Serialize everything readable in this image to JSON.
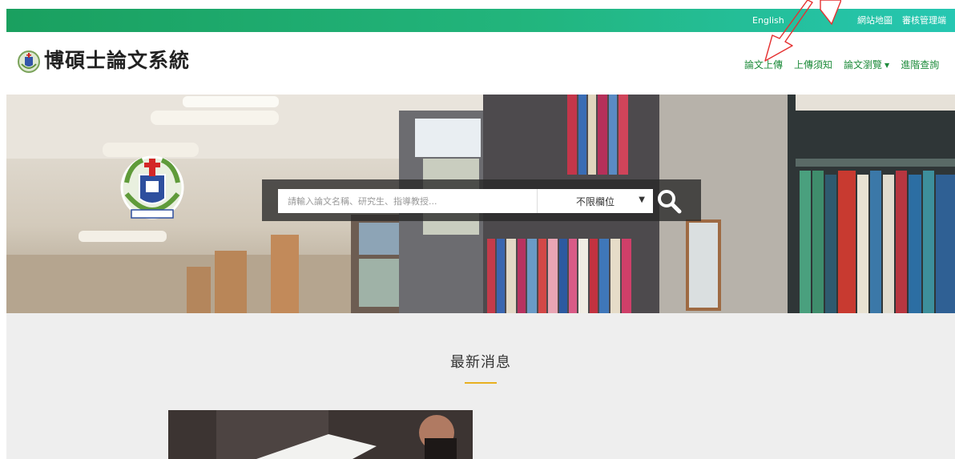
{
  "topbar": {
    "language": "English",
    "sitemap": "網站地圖",
    "admin": "審核管理端"
  },
  "header": {
    "title": "博碩士論文系統",
    "nav": [
      {
        "label": "論文上傳"
      },
      {
        "label": "上傳須知"
      },
      {
        "label": "論文瀏覽",
        "has_dropdown": true
      },
      {
        "label": "進階查詢"
      }
    ]
  },
  "search": {
    "placeholder": "請輸入論文名稱、研究生、指導教授...",
    "field_selected": "不限欄位"
  },
  "news": {
    "title": "最新消息"
  },
  "colors": {
    "topbar_start": "#1aa05f",
    "topbar_end": "#26c7b2",
    "nav_text": "#1f8c3c",
    "accent_underline": "#e8b020",
    "annotation_arrow": "#e53030"
  },
  "icons": {
    "search": "search-icon",
    "dropdown": "caret-down-icon",
    "logo": "university-emblem-icon"
  }
}
